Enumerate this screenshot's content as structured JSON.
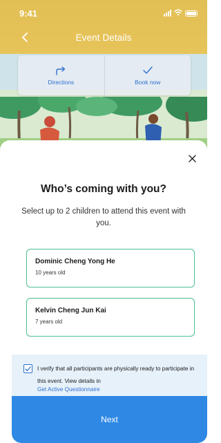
{
  "status_bar": {
    "time": "9:41"
  },
  "header": {
    "title": "Event Details"
  },
  "actions": [
    {
      "label": "Directions",
      "icon": "directions-icon"
    },
    {
      "label": "Book now",
      "icon": "checkmark-icon"
    }
  ],
  "sheet": {
    "title": "Who’s coming with you?",
    "subtitle": "Select up to 2 children to attend this event with you.",
    "children": [
      {
        "name": "Dominic Cheng Yong He",
        "age": "10 years old"
      },
      {
        "name": "Kelvin Cheng Jun Kai",
        "age": "7 years old"
      }
    ],
    "verify": {
      "checked": true,
      "text": "I verify that all participants are physically ready to participate in this event. View details in",
      "link": "Get Active Questionnaire"
    },
    "next_label": "Next"
  },
  "colors": {
    "header": "#e7c45a",
    "accent_blue": "#2f88e4",
    "card_border": "#4ac08f",
    "verify_bg": "#e6f1fa"
  }
}
